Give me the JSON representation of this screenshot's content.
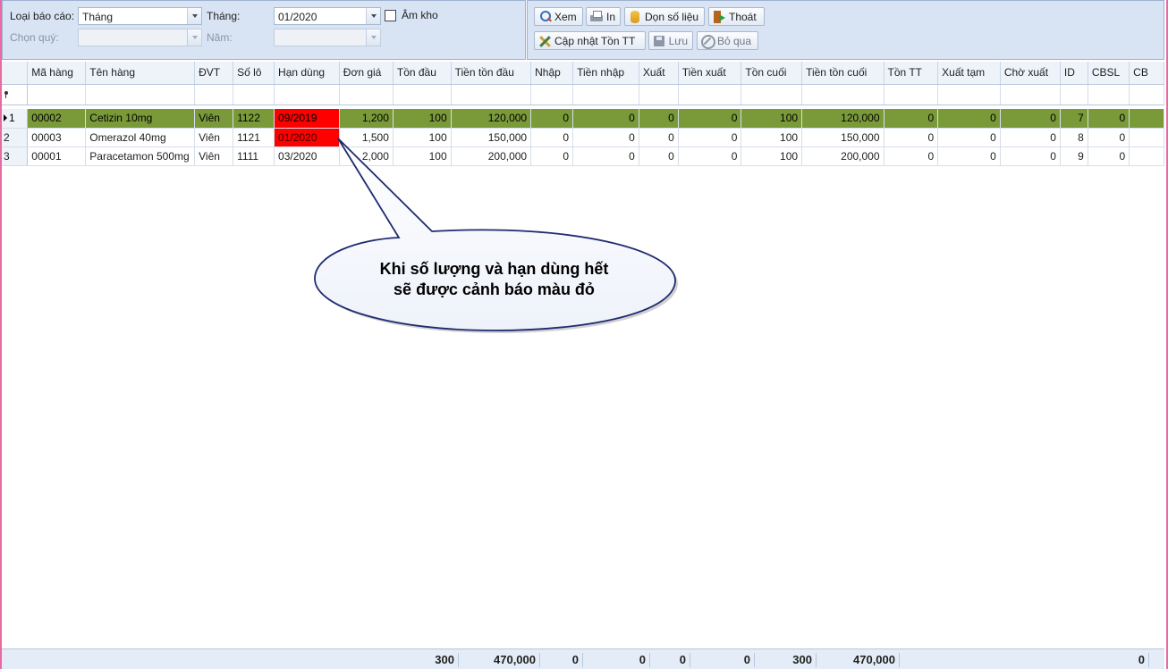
{
  "filter": {
    "report_type_label": "Loại báo cáo:",
    "report_type_value": "Tháng",
    "month_label": "Tháng:",
    "month_value": "01/2020",
    "negative_stock_label": "Âm kho",
    "quarter_label": "Chọn quý:",
    "quarter_value": "",
    "year_label": "Năm:",
    "year_value": ""
  },
  "toolbar": {
    "view_label": "Xem",
    "print_label": "In",
    "cleanup_label": "Dọn số liệu",
    "exit_label": "Thoát",
    "update_stock_label": "Cập nhật Tồn TT",
    "save_label": "Lưu",
    "skip_label": "Bỏ qua"
  },
  "grid": {
    "columns": [
      "Mã hàng",
      "Tên hàng",
      "ĐVT",
      "Số lô",
      "Hạn dùng",
      "Đơn giá",
      "Tồn đầu",
      "Tiền tồn đầu",
      "Nhập",
      "Tiền nhập",
      "Xuất",
      "Tiền xuất",
      "Tồn cuối",
      "Tiền tồn cuối",
      "Tồn TT",
      "Xuất tạm",
      "Chờ xuất",
      "ID",
      "CBSL",
      "CB"
    ],
    "rows": [
      {
        "no": "1",
        "cells": [
          "00002",
          "Cetizin 10mg",
          "Viên",
          "1122",
          "09/2019",
          "1,200",
          "100",
          "120,000",
          "0",
          "0",
          "0",
          "0",
          "100",
          "120,000",
          "0",
          "0",
          "0",
          "7",
          "0",
          ""
        ]
      },
      {
        "no": "2",
        "cells": [
          "00003",
          "Omerazol 40mg",
          "Viên",
          "1121",
          "01/2020",
          "1,500",
          "100",
          "150,000",
          "0",
          "0",
          "0",
          "0",
          "100",
          "150,000",
          "0",
          "0",
          "0",
          "8",
          "0",
          ""
        ]
      },
      {
        "no": "3",
        "cells": [
          "00001",
          "Paracetamon 500mg",
          "Viên",
          "1111",
          "03/2020",
          "2,000",
          "100",
          "200,000",
          "0",
          "0",
          "0",
          "0",
          "100",
          "200,000",
          "0",
          "0",
          "0",
          "9",
          "0",
          ""
        ]
      }
    ],
    "warning_color": "#ff0000",
    "focused_row_color": "#7a9a3a"
  },
  "footer": {
    "ton_dau": "300",
    "tien_ton_dau": "470,000",
    "nhap": "0",
    "tien_nhap": "0",
    "xuat": "0",
    "tien_xuat": "0",
    "ton_cuoi": "300",
    "tien_ton_cuoi": "470,000",
    "cbsl": "0"
  },
  "callout": {
    "line1": "Khi số lượng và hạn dùng hết",
    "line2": "sẽ được cảnh báo màu đỏ"
  }
}
